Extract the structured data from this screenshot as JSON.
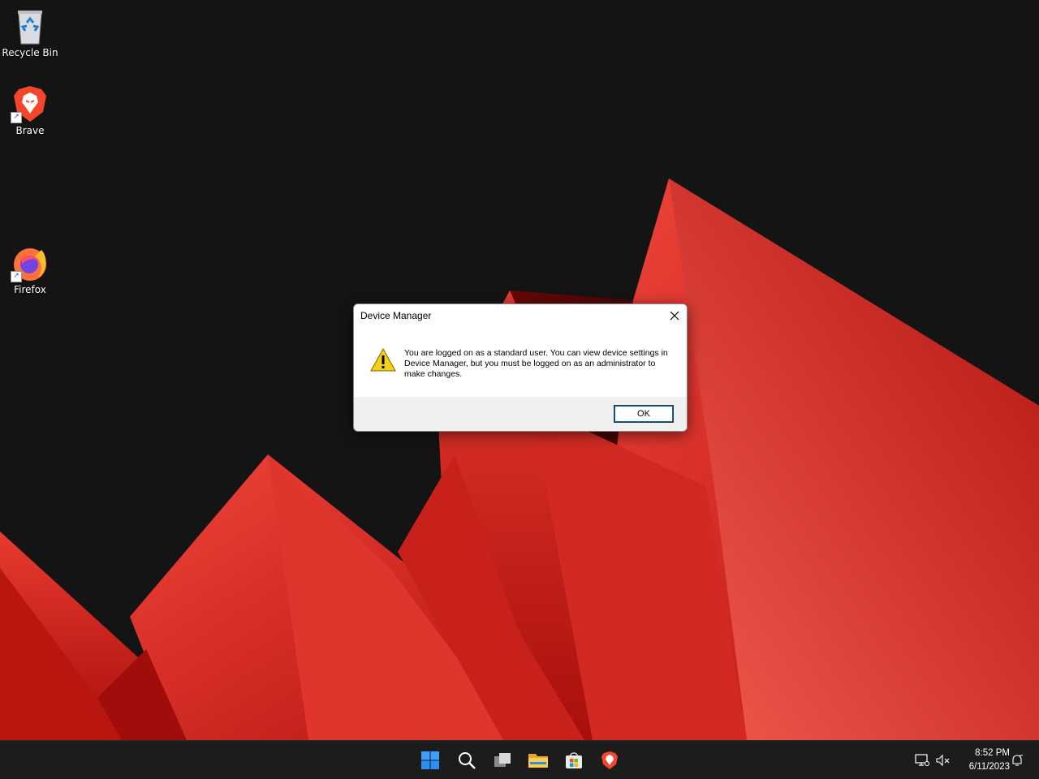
{
  "desktop": {
    "icons": [
      {
        "label": "Recycle Bin",
        "icon": "recycle-bin-icon"
      },
      {
        "label": "Brave",
        "icon": "brave-icon"
      },
      {
        "label": "Firefox",
        "icon": "firefox-icon"
      }
    ]
  },
  "dialog": {
    "title": "Device Manager",
    "message": "You are logged on as a standard user. You can view device settings in Device Manager, but you must be logged on as an administrator to make changes.",
    "ok_label": "OK",
    "icon": "warning-icon"
  },
  "taskbar": {
    "apps": [
      {
        "name": "Start",
        "icon": "windows-start-icon"
      },
      {
        "name": "Search",
        "icon": "search-icon"
      },
      {
        "name": "Task View",
        "icon": "task-view-icon"
      },
      {
        "name": "File Explorer",
        "icon": "folder-icon"
      },
      {
        "name": "Microsoft Store",
        "icon": "store-icon"
      },
      {
        "name": "Brave",
        "icon": "brave-icon"
      }
    ],
    "tray": {
      "network_icon": "network-icon",
      "volume_icon": "volume-muted-icon",
      "time": "8:52 PM",
      "date": "6/11/2023",
      "notification_icon": "notification-icon"
    }
  },
  "colors": {
    "desktop_bg": "#141414",
    "wallpaper_red": "#e8322a",
    "taskbar_bg": "#1c1c1c",
    "accent": "#0067c0"
  }
}
